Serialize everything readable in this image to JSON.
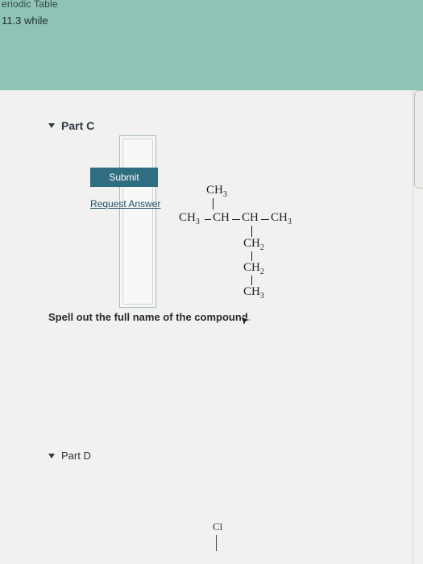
{
  "sidebar": {
    "header": "eriodic Table",
    "subtext": "11.3 while"
  },
  "part_c": {
    "label": "Part C",
    "question": "Spell out the full name of the compound.",
    "answer_value": "",
    "submit_label": "Submit",
    "request_label": "Request Answer"
  },
  "part_d": {
    "label": "Part D"
  },
  "structure": {
    "top_ch3": "CH",
    "top_ch3_sub": "3",
    "left_ch3": "CH",
    "left_ch3_sub": "3",
    "ch_a": "CH",
    "ch_b": "CH",
    "right_ch3": "CH",
    "right_ch3_sub": "3",
    "ch2_a": "CH",
    "ch2_a_sub": "2",
    "ch2_b": "CH",
    "ch2_b_sub": "2",
    "bottom_ch3": "CH",
    "bottom_ch3_sub": "3"
  },
  "part_d_structure": {
    "cl": "Cl"
  }
}
